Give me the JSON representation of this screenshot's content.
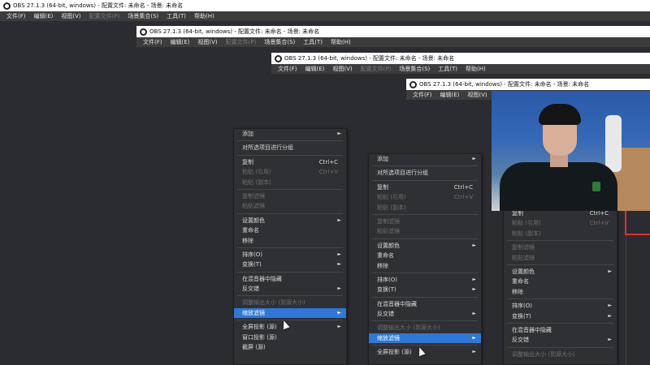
{
  "window_title": "OBS 27.1.3 (64-bit, windows) - 配置文件: 未命名 - 场景: 未命名",
  "menubar": [
    {
      "label": "文件(F)",
      "enabled": true
    },
    {
      "label": "编辑(E)",
      "enabled": true
    },
    {
      "label": "视图(V)",
      "enabled": true
    },
    {
      "label": "配置文件(P)",
      "enabled": false
    },
    {
      "label": "场景集合(S)",
      "enabled": true
    },
    {
      "label": "工具(T)",
      "enabled": true
    },
    {
      "label": "帮助(H)",
      "enabled": true
    }
  ],
  "context_menu": {
    "add": "添加",
    "group": "对所选项目进行分组",
    "copy": "复制",
    "copy_shortcut": "Ctrl+C",
    "paste_ref": "粘贴 (引用)",
    "paste_ref_shortcut": "Ctrl+V",
    "paste_dup": "粘贴 (副本)",
    "copy_filters": "复制滤镜",
    "paste_filters": "粘贴滤镜",
    "set_color": "设置颜色",
    "rename": "重命名",
    "remove": "移除",
    "order": "排序(O)",
    "transform": "变换(T)",
    "hide_in_mixer": "在混音器中隐藏",
    "deinterlace": "反交错",
    "resize_output": "调整输出大小 (到源大小)",
    "scale_filter": "缩放滤镜",
    "fullscreen_projector": "全屏投影 (源)",
    "window_projector": "窗口投影 (源)",
    "screenshot": "截屏 (源)"
  }
}
